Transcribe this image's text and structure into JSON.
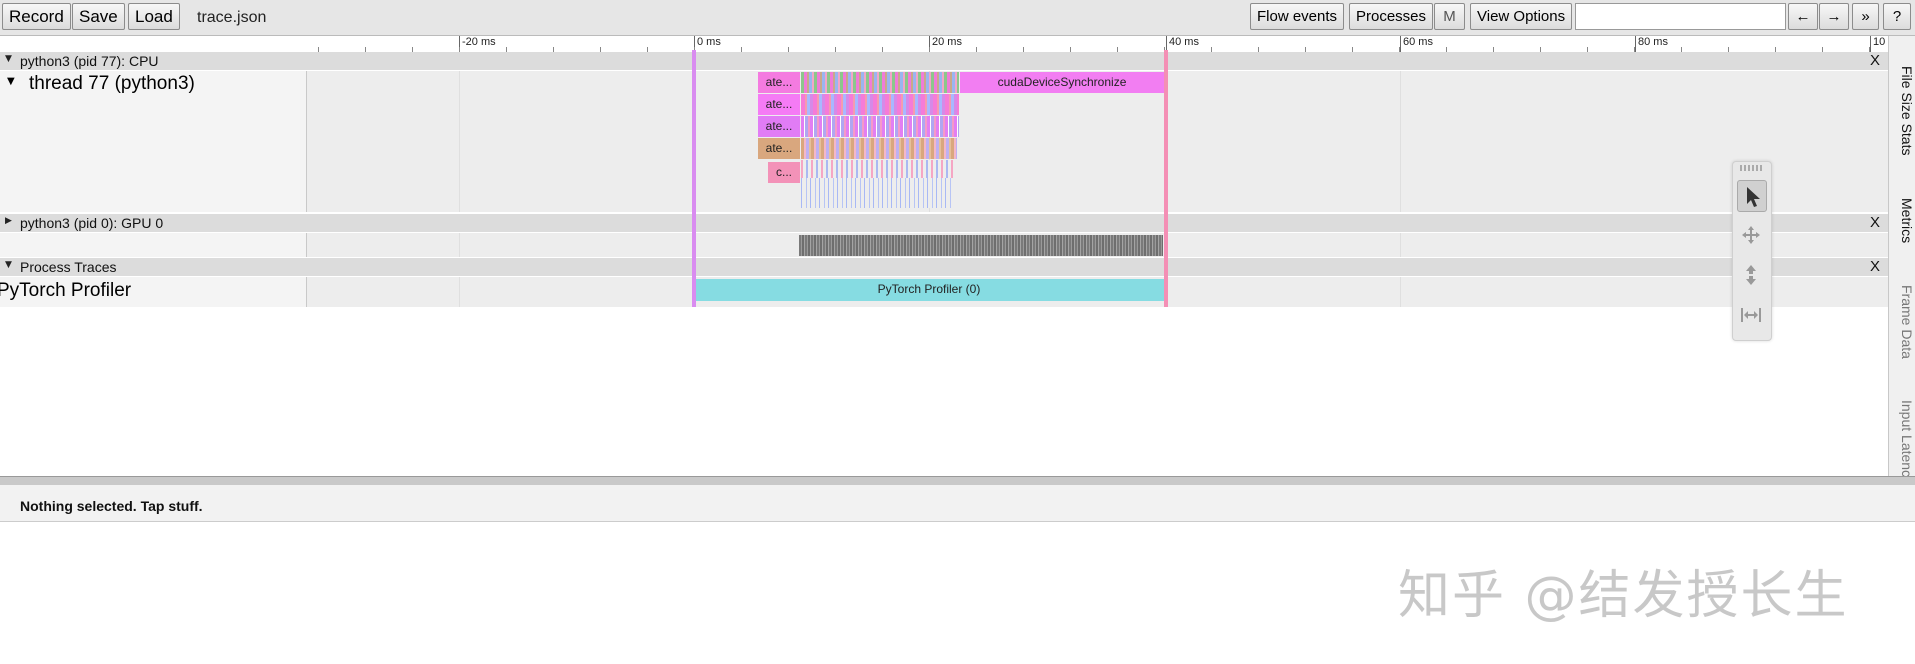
{
  "toolbar": {
    "record_label": "Record",
    "save_label": "Save",
    "load_label": "Load",
    "filename": "trace.json",
    "flow_events_label": "Flow events",
    "processes_label": "Processes",
    "m_label": "M",
    "view_options_label": "View Options",
    "search_value": "",
    "prev_label": "←",
    "next_label": "→",
    "more_label": "»",
    "help_label": "?"
  },
  "ruler": {
    "ticks": [
      "-20 ms",
      "0 ms",
      "20 ms",
      "40 ms",
      "60 ms",
      "80 ms",
      "10"
    ]
  },
  "processes": [
    {
      "header": "python3 (pid 77): CPU",
      "close_label": "X",
      "thread_label": "thread 77 (python3)"
    },
    {
      "header": "python3 (pid 0): GPU 0",
      "close_label": "X"
    },
    {
      "header": "Process Traces",
      "close_label": "X",
      "thread_label": "PyTorch Profiler"
    }
  ],
  "slices": {
    "cuda_sync": "cudaDeviceSynchronize",
    "aten_labels": [
      "ate...",
      "ate...",
      "ate...",
      "ate...",
      "c..."
    ],
    "profiler": "PyTorch Profiler (0)"
  },
  "side_tabs": [
    "File Size Stats",
    "Metrics",
    "Frame Data",
    "Input Latency"
  ],
  "analysis": {
    "message": "Nothing selected. Tap stuff."
  },
  "watermark": "知乎 @结发授长生",
  "colors": {
    "toolbar_bg": "#e6e6e6",
    "header_bg": "#dcdcdc",
    "track_bg": "#ededed",
    "cuda_sync": "#f27ef2",
    "profiler": "#86dce2",
    "marker_left": "#d98cf0",
    "marker_right": "#f48fb5"
  }
}
